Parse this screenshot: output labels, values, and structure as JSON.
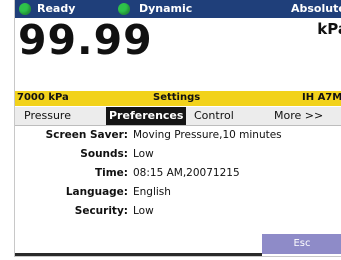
{
  "status": {
    "ready": "Ready",
    "mode": "Dynamic",
    "reference": "Absolute",
    "indicator_color": "#2ec24a"
  },
  "reading": {
    "value": "99.99",
    "unit": "kPa"
  },
  "info_bar": {
    "range": "7000 kPa",
    "title": "Settings",
    "model": "IH A7M"
  },
  "tabs": [
    {
      "label": "Pressure",
      "active": false
    },
    {
      "label": "Preferences",
      "active": true
    },
    {
      "label": "Control",
      "active": false
    },
    {
      "label": "More >>",
      "active": false
    }
  ],
  "settings": [
    {
      "label": "Screen Saver:",
      "value": "Moving Pressure,10 minutes"
    },
    {
      "label": "Sounds:",
      "value": "Low"
    },
    {
      "label": "Time:",
      "value": "08:15 AM,20071215"
    },
    {
      "label": "Language:",
      "value": "English"
    },
    {
      "label": "Security:",
      "value": "Low"
    }
  ],
  "buttons": {
    "esc": "Esc"
  },
  "colors": {
    "status_bar": "#1f3f7a",
    "info_bar": "#f2d21b",
    "active_tab": "#151515",
    "esc_button": "#8e8bc8"
  }
}
